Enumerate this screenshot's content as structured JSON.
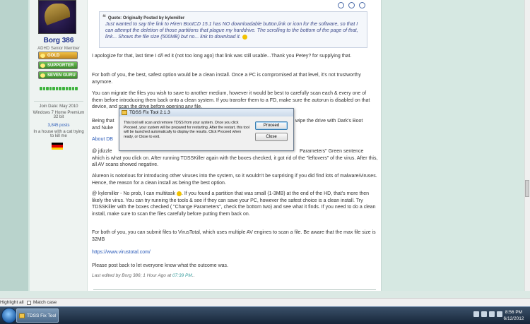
{
  "user": {
    "name": "Borg 386",
    "title": "ADHD Senior Member",
    "badges": [
      "GOLD MEMBER",
      "SUPPORTER",
      "SEVEN GURU"
    ],
    "join_date": "Join Date: May 2010",
    "os": "Windows 7 Home Premium 32 bit",
    "posts": "3,845 posts",
    "location": "In a house with a cat trying to kill me",
    "flag_colors": [
      "#000000",
      "#dd0000",
      "#ffce00"
    ]
  },
  "quote": {
    "prefix": "Quote: Originally Posted by",
    "author": "kylemiller",
    "text": "Just wanted to say the link to Hiren BootCD 15.1 has NO downloadable button,link or icon for the software, so that I can attempt the deletion of those partitions that plague my harddrive. The scrolling to the bottom of the page of that, link... Shows the file size (500MB) but no... link to download it."
  },
  "post": {
    "p1": "I apologize for that, last time I d/l ed it (not too long ago) that link was still usable...Thank you Petey? for supplying that.",
    "p2": "For both of you, the best, safest option would be a clean install. Once a PC is compromised at that level, it's not trustworthy anymore.",
    "p3": "You can migrate the files you wish to save to another medium, however it would be best to carefully scan each & every one of them before introducing them back onto a clean system. If you transfer them to a FD, make sure the autorun is disabled on that device, and scan the drive before opening any file.",
    "p4_start": "Being that",
    "p4_end": "o wipe the drive with Dark's Boot",
    "p4_line2": "and Nuke",
    "p5": "About DB",
    "p6_start": "@ jdizzle",
    "p6_end": "Parameters\" Green sentence",
    "p6_rest": "which is what you click on. After running TDSSKiller again with the boxes checked, it got rid of the \"leftovers\" of the virus. After this, all AV scans showed negative.",
    "p7": "Alureon is notorious for introducing other viruses into the system, so it wouldn't be surprising if you did find lots of malware/viruses. Hence, the reason for a clean install as being the best option.",
    "p8_a": "@ kylemiller - No prob, I can multitask",
    "p8_b": ". If you found a partition that was small (1-3MB) at the end of the HD, that's more then likely the virus. You can try running the tools & see if they can save your PC, however the safest choice is a clean install. Try TDSSKiller with the boxes checked ( \"Change Parameters\", check the bottom two) and see what it finds. If you need to do a clean install, make sure to scan the files carefully before putting them back on.",
    "p9": "For both of you, you can submit files to VirusTotal, which uses multiple AV engines to scan a file. Be aware that the max file size is 32MB",
    "link": "https://www.virustotal.com/",
    "p10": "Please post back to let everyone know what the outcome was.",
    "edit_prefix": "Last edited by Borg 386; 1 Hour Ago at",
    "edit_time": "07:39 PM",
    "edit_suffix": ".."
  },
  "dialog": {
    "title": "TDSS Fix Tool 2.1.3",
    "message": "This tool will scan and remove TDSS from your system. Once you click Proceed, your system will be prepared for restarting.  After the restart, this tool will be launched automatically to display the results.  Click Proceed when ready, or Close to exit.",
    "proceed": "Proceed",
    "close": "Close"
  },
  "findbar": {
    "highlight": "Highlight all",
    "match_case": "Match case"
  },
  "taskbar": {
    "app": "TDSS Fix Tool 2.1.3",
    "time": "8:56 PM",
    "date": "6/12/2012"
  }
}
